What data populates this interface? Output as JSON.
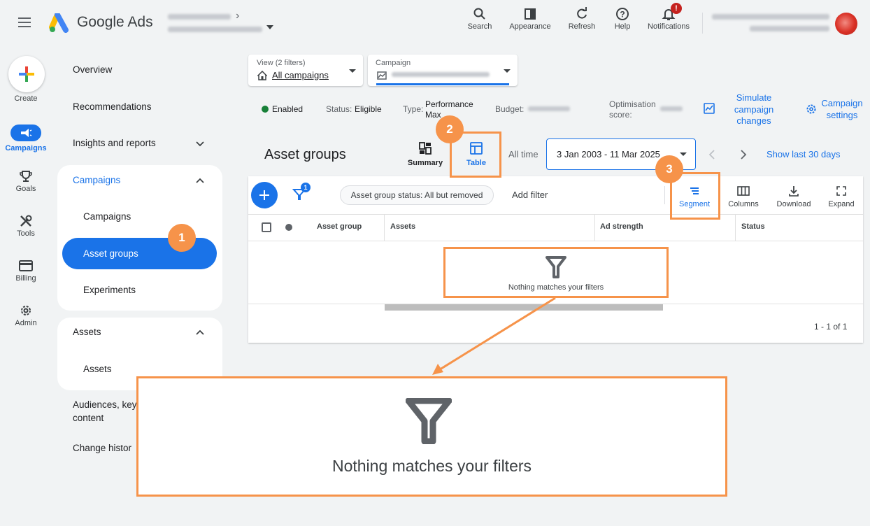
{
  "header": {
    "app_name": "Google Ads",
    "buttons": [
      {
        "label": "Search",
        "icon": "search-icon"
      },
      {
        "label": "Appearance",
        "icon": "appearance-icon"
      },
      {
        "label": "Refresh",
        "icon": "refresh-icon"
      },
      {
        "label": "Help",
        "icon": "help-icon"
      },
      {
        "label": "Notifications",
        "icon": "bell-icon"
      }
    ],
    "notification_badge": "!"
  },
  "rail": {
    "create": "Create",
    "items": [
      {
        "label": "Campaigns",
        "icon": "megaphone-icon",
        "active": true
      },
      {
        "label": "Goals",
        "icon": "trophy-icon"
      },
      {
        "label": "Tools",
        "icon": "tools-icon"
      },
      {
        "label": "Billing",
        "icon": "card-icon"
      },
      {
        "label": "Admin",
        "icon": "gear-icon"
      }
    ]
  },
  "nav": {
    "overview": "Overview",
    "recommendations": "Recommendations",
    "insights": "Insights and reports",
    "campaigns_group": "Campaigns",
    "campaigns": "Campaigns",
    "asset_groups": "Asset groups",
    "experiments": "Experiments",
    "assets_group": "Assets",
    "assets": "Assets",
    "audiences": "Audiences, key",
    "content": "content",
    "change_history": "Change histor"
  },
  "filters": {
    "view_label": "View (2 filters)",
    "view_value": "All campaigns",
    "campaign_label": "Campaign"
  },
  "status_bar": {
    "enabled": "Enabled",
    "status_label": "Status:",
    "status_value": "Eligible",
    "type_label": "Type:",
    "type_value_1": "Performance",
    "type_value_2": "Max",
    "budget_label": "Budget:",
    "opt_label_1": "Optimisation",
    "opt_label_2": "score:",
    "simulate_1": "Simulate",
    "simulate_2": "campaign",
    "simulate_3": "changes",
    "settings_1": "Campaign",
    "settings_2": "settings"
  },
  "page": {
    "title": "Asset groups",
    "summary": "Summary",
    "table": "Table",
    "all_time": "All time",
    "date_range": "3 Jan 2003 - 11 Mar 2025",
    "show_last": "Show last 30 days"
  },
  "toolbar": {
    "filter_count": "1",
    "status_chip": "Asset group status: All but removed",
    "add_filter": "Add filter",
    "segment": "Segment",
    "columns": "Columns",
    "download": "Download",
    "expand": "Expand"
  },
  "table": {
    "headers": [
      "Asset group",
      "Assets",
      "Ad strength",
      "Status"
    ],
    "empty": "Nothing matches your filters",
    "pagination": "1 - 1 of 1"
  },
  "callout": {
    "empty": "Nothing matches your filters"
  },
  "badges": [
    "1",
    "2",
    "3"
  ],
  "colors": {
    "accent": "#1a73e8",
    "highlight": "#f6934a",
    "enabled": "#188038"
  }
}
